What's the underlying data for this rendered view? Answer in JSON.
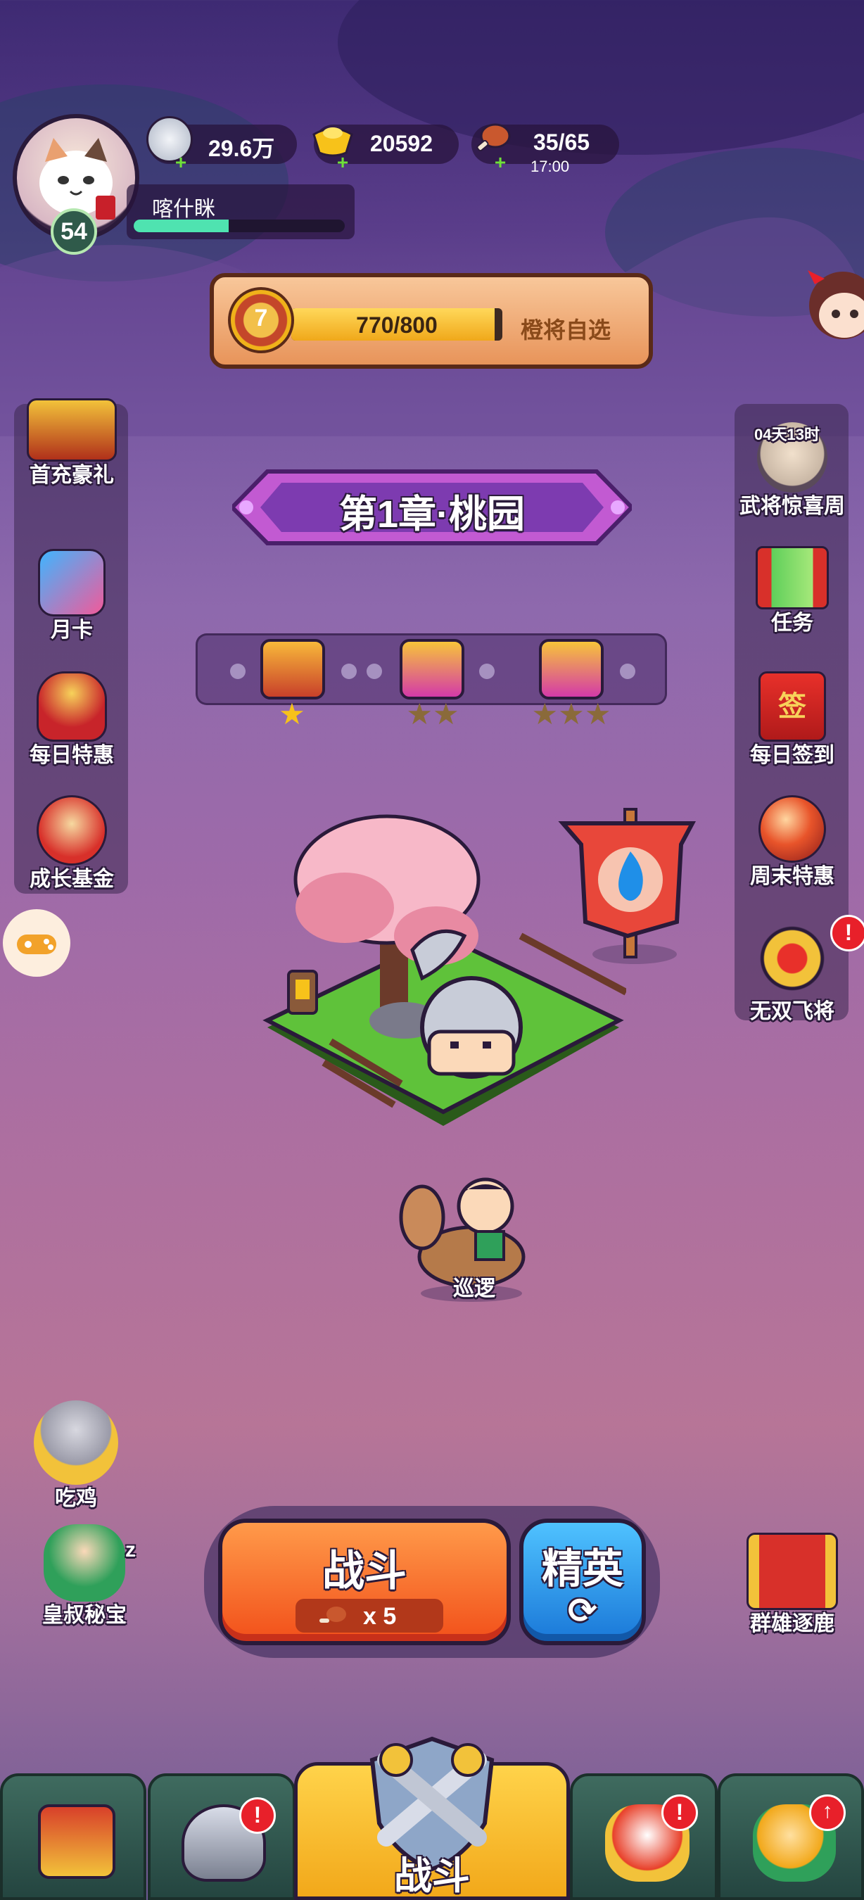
{
  "player": {
    "name": "喀什眯",
    "level": "54",
    "xp_fraction": 0.45
  },
  "resources": {
    "silver": "29.6万",
    "gold": "20592",
    "stamina": "35/65",
    "stamina_timer": "17:00"
  },
  "progress": {
    "rank": "7",
    "value": "770/800",
    "fraction": 0.9625,
    "action_label": "橙将自选"
  },
  "chapter": {
    "title": "第1章·桃园"
  },
  "stage_stars": [
    "★",
    "★★",
    "★★★"
  ],
  "left_menu": [
    {
      "label": "首充豪礼",
      "icon": "treasure-chest-icon"
    },
    {
      "label": "月卡",
      "icon": "monthly-card-icon"
    },
    {
      "label": "每日特惠",
      "icon": "gift-bag-icon"
    },
    {
      "label": "成长基金",
      "icon": "fund-monkey-icon"
    }
  ],
  "right_menu": [
    {
      "label": "武将惊喜周",
      "icon": "sage-general-icon",
      "timer": "04天13时"
    },
    {
      "label": "任务",
      "icon": "scroll-task-icon"
    },
    {
      "label": "每日签到",
      "icon": "sign-in-envelope-icon",
      "glyph": "签"
    },
    {
      "label": "周末特惠",
      "icon": "weekend-orb-icon"
    },
    {
      "label": "无双飞将",
      "icon": "peerless-general-icon"
    }
  ],
  "patrol_label": "巡逻",
  "left_bottom": [
    {
      "label": "吃鸡",
      "icon": "sunglasses-hero-icon"
    },
    {
      "label": "皇叔秘宝",
      "icon": "sleeping-uncle-icon"
    }
  ],
  "sleep_glyph": "z",
  "right_bottom": {
    "label": "群雄逐鹿",
    "icon": "war-scroll-icon"
  },
  "battle_button": {
    "label": "战斗",
    "cost": "x 5"
  },
  "elite_button": {
    "label": "精英"
  },
  "nav": {
    "battle_label": "战斗"
  },
  "badge_glyph": "!",
  "colors": {
    "accent_orange": "#ff6a2a",
    "elite_blue": "#1f8fe8",
    "nav_gold": "#f7b81c",
    "alert_red": "#e8202a"
  }
}
